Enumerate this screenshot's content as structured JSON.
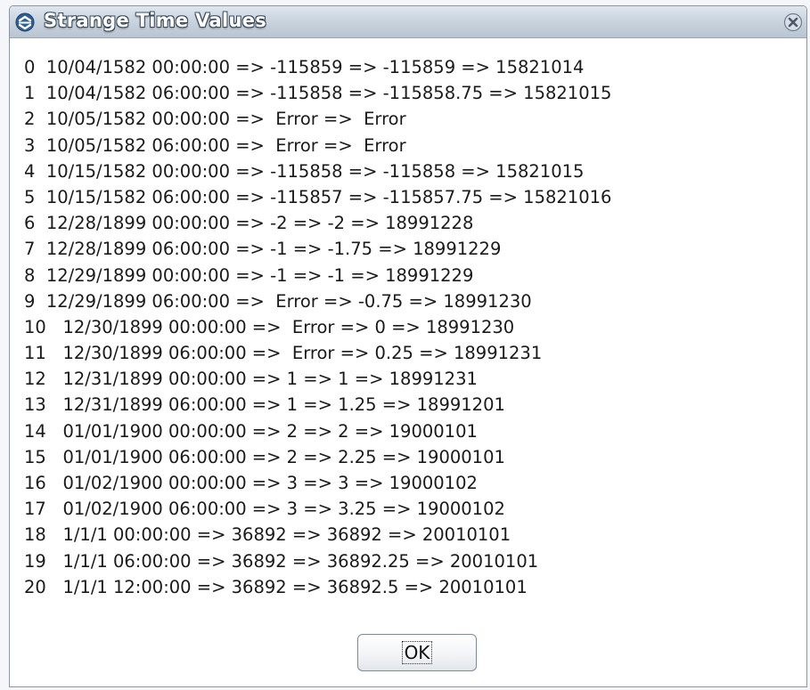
{
  "window": {
    "title": "Strange Time Values",
    "ok_label": "OK"
  },
  "rows": [
    {
      "idx": "0",
      "text": "10/04/1582 00:00:00 => -115859 => -115859 => 15821014"
    },
    {
      "idx": "1",
      "text": "10/04/1582 06:00:00 => -115858 => -115858.75 => 15821015"
    },
    {
      "idx": "2",
      "text": "10/05/1582 00:00:00 =>  Error =>  Error"
    },
    {
      "idx": "3",
      "text": "10/05/1582 06:00:00 =>  Error =>  Error"
    },
    {
      "idx": "4",
      "text": "10/15/1582 00:00:00 => -115858 => -115858 => 15821015"
    },
    {
      "idx": "5",
      "text": "10/15/1582 06:00:00 => -115857 => -115857.75 => 15821016"
    },
    {
      "idx": "6",
      "text": "12/28/1899 00:00:00 => -2 => -2 => 18991228"
    },
    {
      "idx": "7",
      "text": "12/28/1899 06:00:00 => -1 => -1.75 => 18991229"
    },
    {
      "idx": "8",
      "text": "12/29/1899 00:00:00 => -1 => -1 => 18991229"
    },
    {
      "idx": "9",
      "text": "12/29/1899 06:00:00 =>  Error => -0.75 => 18991230"
    },
    {
      "idx": "10",
      "text": "12/30/1899 00:00:00 =>  Error => 0 => 18991230"
    },
    {
      "idx": "11",
      "text": "12/30/1899 06:00:00 =>  Error => 0.25 => 18991231"
    },
    {
      "idx": "12",
      "text": "12/31/1899 00:00:00 => 1 => 1 => 18991231"
    },
    {
      "idx": "13",
      "text": "12/31/1899 06:00:00 => 1 => 1.25 => 18991201"
    },
    {
      "idx": "14",
      "text": "01/01/1900 00:00:00 => 2 => 2 => 19000101"
    },
    {
      "idx": "15",
      "text": "01/01/1900 06:00:00 => 2 => 2.25 => 19000101"
    },
    {
      "idx": "16",
      "text": "01/02/1900 00:00:00 => 3 => 3 => 19000102"
    },
    {
      "idx": "17",
      "text": "01/02/1900 06:00:00 => 3 => 3.25 => 19000102"
    },
    {
      "idx": "18",
      "text": "1/1/1 00:00:00 => 36892 => 36892 => 20010101"
    },
    {
      "idx": "19",
      "text": "1/1/1 06:00:00 => 36892 => 36892.25 => 20010101"
    },
    {
      "idx": "20",
      "text": "1/1/1 12:00:00 => 36892 => 36892.5 => 20010101"
    }
  ],
  "icons": {
    "app": "app-menu-icon",
    "close": "close-icon"
  },
  "colors": {
    "title_text": "#ffffff",
    "title_outline": "#3a4a5c",
    "titlebar": "#c6d1dc",
    "text": "#1a1a1a"
  }
}
